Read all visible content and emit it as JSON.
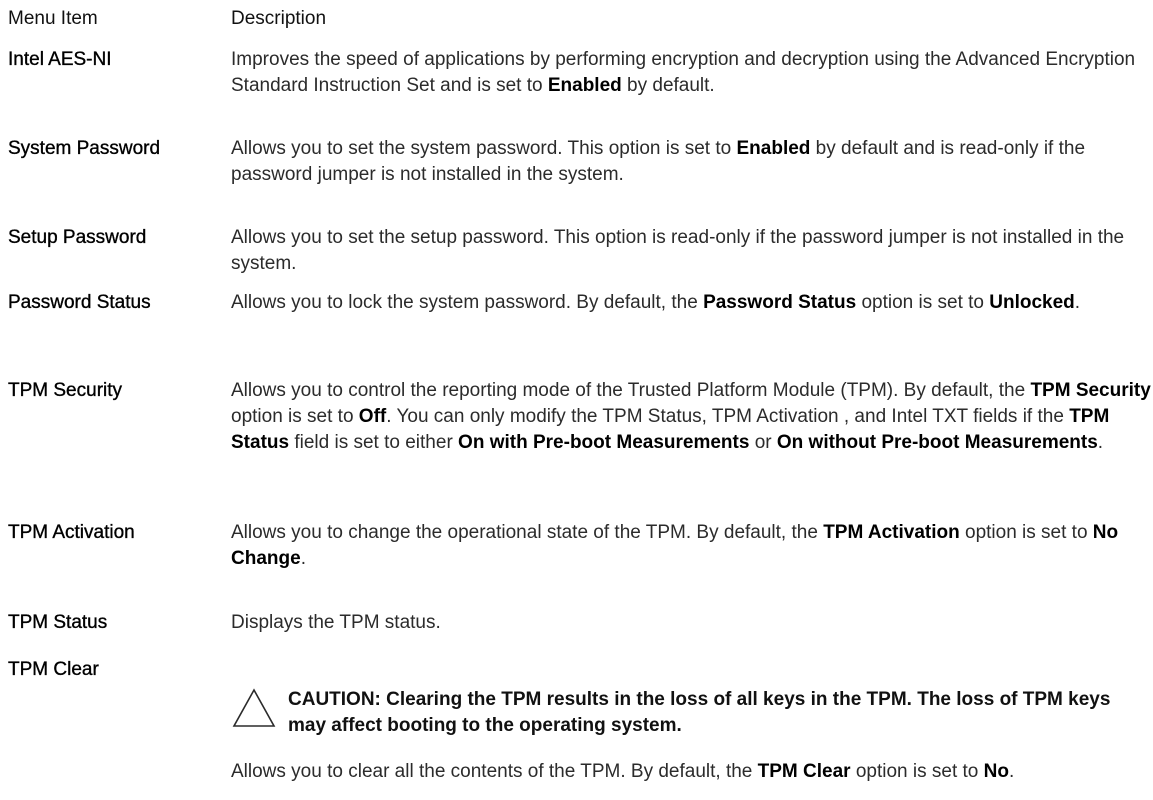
{
  "table": {
    "headers": {
      "item": "Menu Item",
      "description": "Description"
    },
    "rows": [
      {
        "name": "Intel AES-NI",
        "parts": [
          {
            "t": "Improves the speed of applications by performing encryption and decryption using the Advanced Encryption Standard Instruction Set and is set to "
          },
          {
            "t": "Enabled",
            "b": true
          },
          {
            "t": " by default."
          }
        ]
      },
      {
        "name": "System Password",
        "parts": [
          {
            "t": "Allows you to set the system password. This option is set to "
          },
          {
            "t": "Enabled",
            "b": true
          },
          {
            "t": " by default and is read-only if the password jumper is not installed in the system."
          }
        ]
      },
      {
        "name": "Setup Password",
        "parts": [
          {
            "t": "Allows you to set the setup password. This option is read-only if the password jumper is not installed in the system."
          }
        ]
      },
      {
        "name": "Password Status",
        "parts": [
          {
            "t": "Allows you to lock the system password. By default, the "
          },
          {
            "t": "Password Status",
            "b": true
          },
          {
            "t": " option is set to "
          },
          {
            "t": "Unlocked",
            "b": true
          },
          {
            "t": "."
          }
        ]
      },
      {
        "name": "TPM Security",
        "parts": [
          {
            "t": "Allows you to control the reporting mode of the Trusted Platform Module (TPM). By default, the "
          },
          {
            "t": "TPM Security",
            "b": true
          },
          {
            "t": " option is set to "
          },
          {
            "t": "Off",
            "b": true
          },
          {
            "t": ". You can only modify the TPM Status, TPM Activation , and Intel TXT fields if the "
          },
          {
            "t": "TPM Status",
            "b": true
          },
          {
            "t": " field is set to either "
          },
          {
            "t": "On with Pre-boot Measurements",
            "b": true
          },
          {
            "t": " or "
          },
          {
            "t": "On without Pre-boot Measurements",
            "b": true
          },
          {
            "t": "."
          }
        ]
      },
      {
        "name": "TPM Activation",
        "parts": [
          {
            "t": "Allows you to change the operational state of the TPM. By default, the "
          },
          {
            "t": "TPM Activation",
            "b": true
          },
          {
            "t": " option is set to "
          },
          {
            "t": "No Change",
            "b": true
          },
          {
            "t": "."
          }
        ]
      },
      {
        "name": "TPM Status",
        "parts": [
          {
            "t": "Displays the TPM status."
          }
        ]
      },
      {
        "name": "TPM Clear",
        "caution": "CAUTION: Clearing the TPM results in the loss of all keys in the TPM. The loss of TPM keys may affect booting to the operating system.",
        "parts": [
          {
            "t": "Allows you to clear all the contents of the TPM. By default, the "
          },
          {
            "t": "TPM Clear",
            "b": true
          },
          {
            "t": " option is set to "
          },
          {
            "t": "No",
            "b": true
          },
          {
            "t": "."
          }
        ]
      }
    ]
  },
  "icons": {
    "caution": "caution-triangle-icon"
  }
}
